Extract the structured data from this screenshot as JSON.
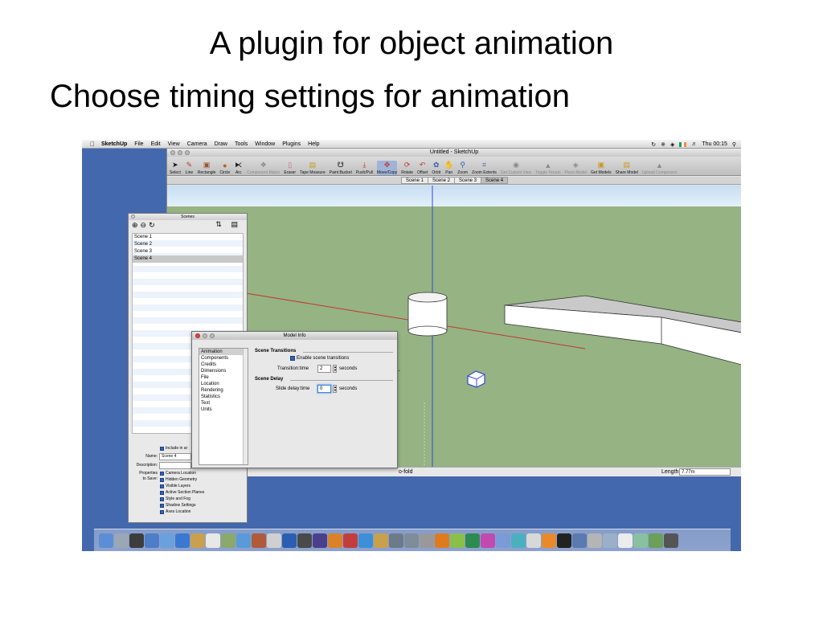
{
  "slide": {
    "title": "A plugin for object animation",
    "subtitle": "Choose timing settings for animation"
  },
  "menubar": {
    "apple_icon": "apple-logo-icon",
    "items": [
      "SketchUp",
      "File",
      "Edit",
      "View",
      "Camera",
      "Draw",
      "Tools",
      "Window",
      "Plugins",
      "Help"
    ],
    "clock": "Thu 00:15"
  },
  "sketchup_window": {
    "title": "Untitled - SketchUp",
    "toolbar": [
      {
        "label": "Select",
        "icon": "arrow-cursor-icon",
        "enabled": true
      },
      {
        "label": "Line",
        "icon": "pencil-icon",
        "enabled": true
      },
      {
        "label": "Rectangle",
        "icon": "rectangle-icon",
        "enabled": true
      },
      {
        "label": "Circle",
        "icon": "circle-icon",
        "enabled": true
      },
      {
        "label": "Arc",
        "icon": "arc-icon",
        "enabled": true
      },
      {
        "label": "Component Maker",
        "icon": "component-icon",
        "enabled": false
      },
      {
        "label": "Eraser",
        "icon": "eraser-icon",
        "enabled": true
      },
      {
        "label": "Tape Measure",
        "icon": "tape-measure-icon",
        "enabled": true
      },
      {
        "label": "Paint Bucket",
        "icon": "paint-bucket-icon",
        "enabled": true
      },
      {
        "label": "Push/Pull",
        "icon": "push-pull-icon",
        "enabled": true
      },
      {
        "label": "Move/Copy",
        "icon": "move-icon",
        "enabled": true,
        "selected": true
      },
      {
        "label": "Rotate",
        "icon": "rotate-icon",
        "enabled": true
      },
      {
        "label": "Offset",
        "icon": "offset-icon",
        "enabled": true
      },
      {
        "label": "Orbit",
        "icon": "orbit-icon",
        "enabled": true
      },
      {
        "label": "Pan",
        "icon": "hand-icon",
        "enabled": true
      },
      {
        "label": "Zoom",
        "icon": "magnifier-icon",
        "enabled": true
      },
      {
        "label": "Zoom Extents",
        "icon": "zoom-extents-icon",
        "enabled": true
      },
      {
        "label": "Get Current View",
        "icon": "current-view-icon",
        "enabled": false
      },
      {
        "label": "Toggle Terrain",
        "icon": "terrain-icon",
        "enabled": false
      },
      {
        "label": "Place Model",
        "icon": "place-model-icon",
        "enabled": false
      },
      {
        "label": "Get Models",
        "icon": "get-models-icon",
        "enabled": true
      },
      {
        "label": "Share Model",
        "icon": "share-model-icon",
        "enabled": true
      },
      {
        "label": "Upload Component",
        "icon": "upload-icon",
        "enabled": false
      }
    ],
    "scene_tabs": [
      "Scene 1",
      "Scene 2",
      "Scene 3",
      "Scene 4"
    ],
    "active_scene_tab": "Scene 4",
    "status_hint": "o-fold",
    "length_label": "Length",
    "length_value": "7.77m"
  },
  "scenes_panel": {
    "title": "Scenes",
    "scenes": [
      "Scene 1",
      "Scene 2",
      "Scene 3",
      "Scene 4"
    ],
    "selected_scene": "Scene 4",
    "include_label": "Include in ar",
    "name_label": "Name:",
    "name_value": "Scene 4",
    "description_label": "Description:",
    "properties_label_1": "Properties",
    "properties_label_2": "to Save:",
    "properties": [
      "Camera Location",
      "Hidden Geometry",
      "Visible Layers",
      "Active Section Planes",
      "Style and Fog",
      "Shadow Settings",
      "Axes Location"
    ]
  },
  "model_info": {
    "title": "Model Info",
    "categories": [
      "Animation",
      "Components",
      "Credits",
      "Dimensions",
      "File",
      "Location",
      "Rendering",
      "Statistics",
      "Text",
      "Units"
    ],
    "selected_category": "Animation",
    "scene_transitions_header": "Scene Transitions",
    "enable_transitions_label": "Enable scene transitions",
    "transition_time_label": "Transition:time",
    "transition_time_value": "2",
    "transition_unit": "seconds",
    "scene_delay_header": "Scene Delay",
    "slide_delay_label": "Slide delay:time",
    "slide_delay_value": "0",
    "slide_delay_unit": "seconds"
  },
  "colors": {
    "desktop": "#4468ad",
    "ground": "#95b383",
    "sky": "#c6def3",
    "red_axis": "#c23a2f",
    "blue_axis": "#3447d6",
    "green_axis": "#2f9a2f"
  }
}
